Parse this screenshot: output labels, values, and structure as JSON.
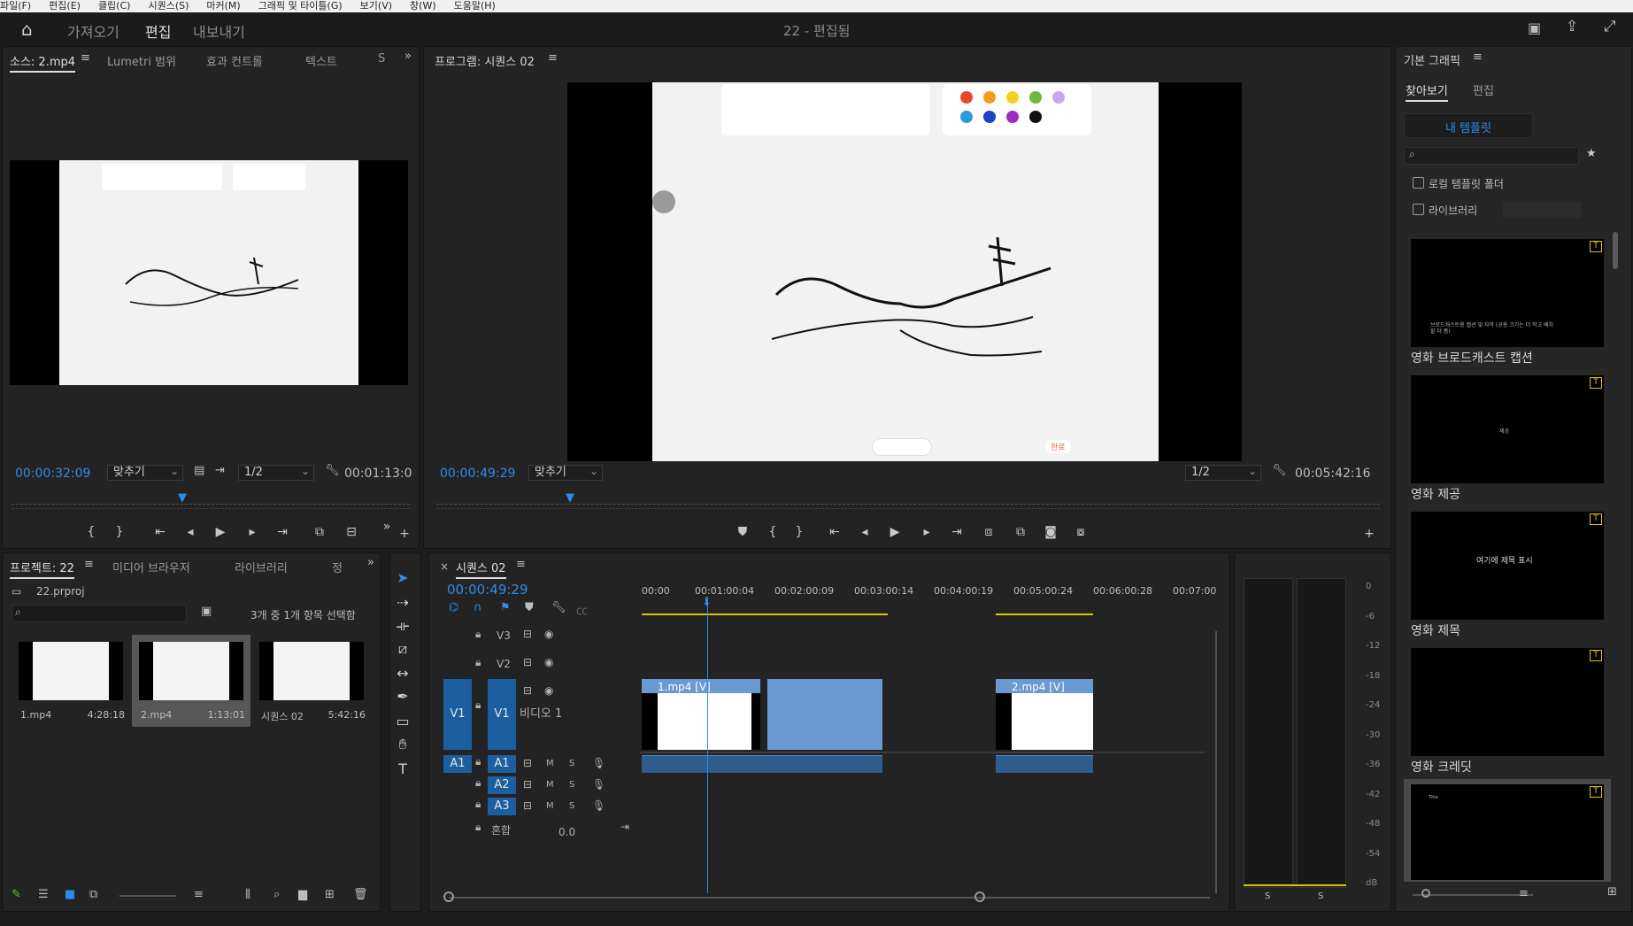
{
  "menu": [
    "파일(F)",
    "편집(E)",
    "클립(C)",
    "시퀀스(S)",
    "마커(M)",
    "그래픽 및 타이틀(G)",
    "보기(V)",
    "창(W)",
    "도움말(H)"
  ],
  "workspace": {
    "tabs": [
      "가져오기",
      "편집",
      "내보내기"
    ],
    "active": "편집",
    "title": "22 - 편집됨"
  },
  "source_panel": {
    "tabs": [
      "소스: 2.mp4",
      "Lumetri 범위",
      "효과 컨트롤",
      "텍스트",
      "S"
    ],
    "timecode": "00:00:32:09",
    "fit": "맞추기",
    "resolution": "1/2",
    "duration": "00:01:13:0",
    "in_mark": "{",
    "out_mark": "}"
  },
  "program_panel": {
    "title": "프로그램: 시퀀스 02",
    "timecode": "00:00:49:29",
    "fit": "맞추기",
    "resolution": "1/2",
    "duration": "00:05:42:16",
    "done_label": "완료"
  },
  "project_panel": {
    "tabs": [
      "프로젝트: 22",
      "미디어 브라우저",
      "라이브러리",
      "정"
    ],
    "file": "22.prproj",
    "selection": "3개 중 1개 항목 선택함",
    "items": [
      {
        "name": "1.mp4",
        "duration": "4:28:18"
      },
      {
        "name": "2.mp4",
        "duration": "1:13:01"
      },
      {
        "name": "시퀀스 02",
        "duration": "5:42:16"
      }
    ]
  },
  "timeline": {
    "tab": "시퀀스 02",
    "timecode": "00:00:49:29",
    "ruler": [
      "00:00",
      "00:01:00:04",
      "00:02:00:09",
      "00:03:00:14",
      "00:04:00:19",
      "00:05:00:24",
      "00:06:00:28",
      "00:07:00"
    ],
    "video_tracks": [
      "V3",
      "V2",
      "V1"
    ],
    "video_track_name": "비디오 1",
    "audio_tracks": [
      "A1",
      "A2",
      "A3"
    ],
    "mix_label": "혼합",
    "mix_value": "0.0",
    "m_label": "M",
    "s_label": "S",
    "clips": [
      {
        "label": "1.mp4 [V]"
      },
      {
        "label": "2.mp4 [V]"
      }
    ]
  },
  "audio_meter": {
    "scale": [
      "0",
      "-6",
      "-12",
      "-18",
      "-24",
      "-30",
      "-36",
      "-42",
      "-48",
      "-54",
      "dB"
    ],
    "solo": [
      "S",
      "S"
    ]
  },
  "essential_graphics": {
    "title": "기본 그래픽",
    "tabs": [
      "찾아보기",
      "편집"
    ],
    "my_templates": "내 템플릿",
    "local_folder": "로컬 템플릿 폴더",
    "libraries": "라이브러리",
    "templates": [
      {
        "label": "영화 브로드캐스트 캡션",
        "preview_text": "브로드캐스트용 캡션 및 자막 (공용 크기는 더 작고 배치할 더 폼)"
      },
      {
        "label": "영화 제공",
        "preview_text": "제공"
      },
      {
        "label": "영화 제목",
        "preview_text": "여기에 제목 표시"
      },
      {
        "label": "영화 크레딧",
        "preview_text": ""
      },
      {
        "label": "",
        "preview_text": "Title"
      }
    ]
  },
  "colors": {
    "accent": "#2d8ceb",
    "clip": "#6b9ad2",
    "track_select": "#1c5fa0",
    "badge": "#e6c200"
  }
}
